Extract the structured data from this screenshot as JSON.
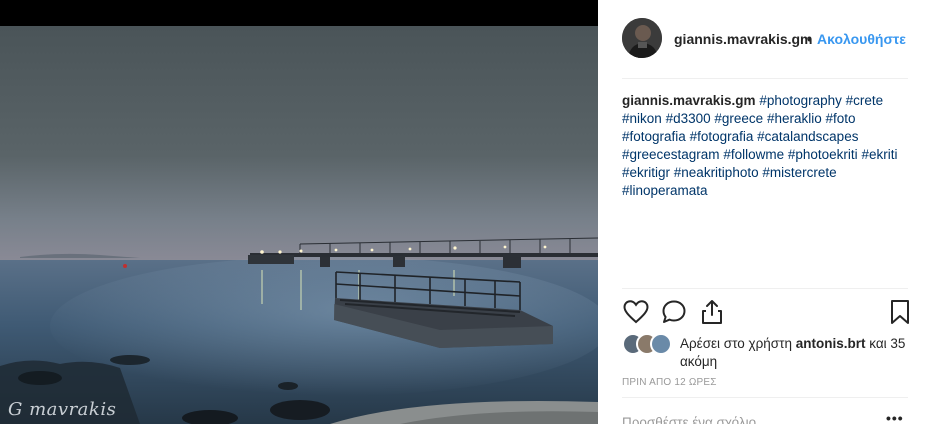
{
  "post": {
    "username": "giannis.mavrakis.gm",
    "separator": "•",
    "follow_label": "Ακολουθήστε",
    "watermark": "G mavrakis",
    "caption_user": "giannis.mavrakis.gm",
    "hashtags": [
      "#photography",
      "#crete",
      "#nikon",
      "#d3300",
      "#greece",
      "#heraklio",
      "#foto",
      "#fotografia",
      "#fotografia",
      "#catalandscapes",
      "#greecestagram",
      "#followme",
      "#photoekriti",
      "#ekriti",
      "#ekritigr",
      "#neakritiphoto",
      "#mistercrete",
      "#linoperamata"
    ],
    "likes_prefix": "Αρέσει στο χρήστη",
    "likes_user": "antonis.brt",
    "likes_suffix": "και 35 ακόμη",
    "time_ago": "ΠΡΙΝ ΑΠΟ 12 ΩΡΕΣ",
    "comment_placeholder": "Προσθέστε ένα σχόλιο...",
    "more_label": "•••",
    "icons": [
      "heart-icon",
      "comment-icon",
      "share-icon",
      "bookmark-icon"
    ],
    "colors": {
      "link_blue": "#3897f0",
      "hashtag": "#003569",
      "muted": "#999999",
      "text": "#262626"
    }
  }
}
